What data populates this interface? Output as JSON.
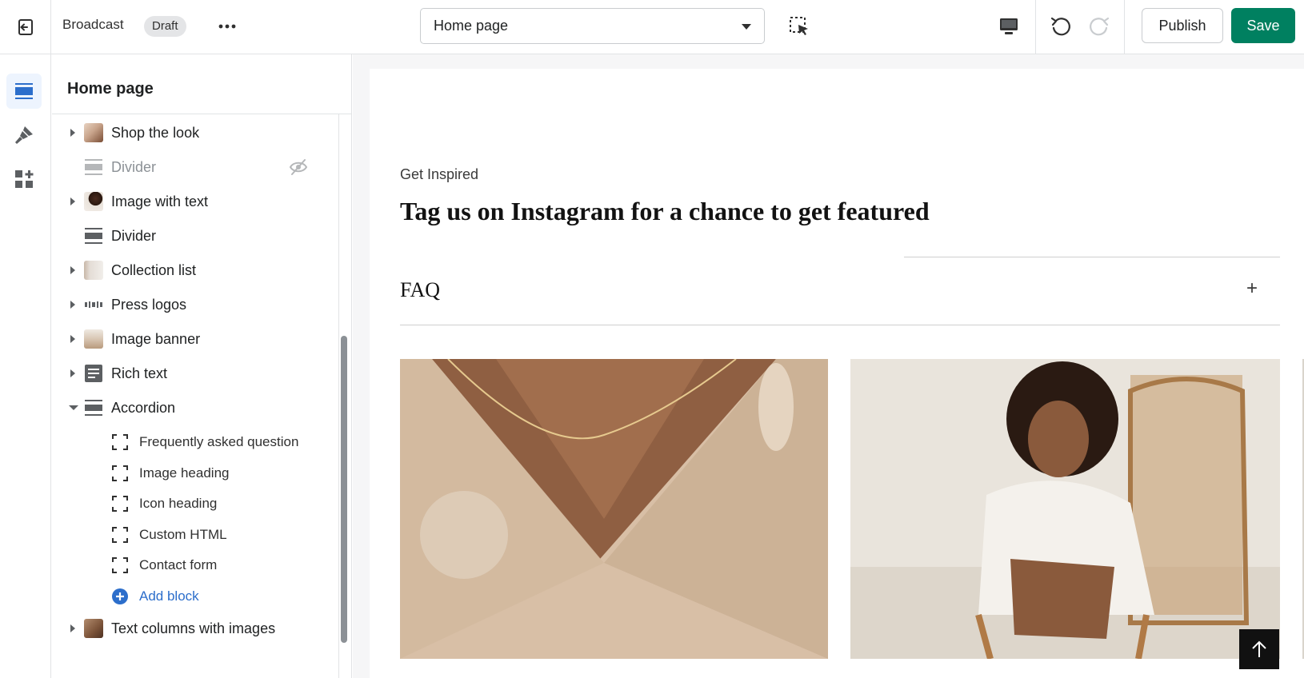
{
  "topbar": {
    "theme_name": "Broadcast",
    "status_badge": "Draft",
    "page_select": {
      "value": "Home page"
    },
    "publish_label": "Publish",
    "save_label": "Save",
    "save_color": "#008060"
  },
  "rail": {
    "items": [
      {
        "icon": "sections-icon",
        "active": true
      },
      {
        "icon": "theme-settings-brush-icon",
        "active": false
      },
      {
        "icon": "app-blocks-icon",
        "active": false
      }
    ]
  },
  "sidebar": {
    "title": "Home page",
    "sections": [
      {
        "label": "Shop the look",
        "expandable": true,
        "thumb": "photo"
      },
      {
        "label": "Divider",
        "expandable": false,
        "hidden": true,
        "thumb": "divider-icon"
      },
      {
        "label": "Image with text",
        "expandable": true,
        "thumb": "photo"
      },
      {
        "label": "Divider",
        "expandable": false,
        "thumb": "divider-icon"
      },
      {
        "label": "Collection list",
        "expandable": true,
        "thumb": "photo"
      },
      {
        "label": "Press logos",
        "expandable": true,
        "thumb": "logos"
      },
      {
        "label": "Image banner",
        "expandable": true,
        "thumb": "photo"
      },
      {
        "label": "Rich text",
        "expandable": true,
        "thumb": "text-icon"
      },
      {
        "label": "Accordion",
        "expandable": true,
        "expanded": true,
        "thumb": "divider-icon"
      }
    ],
    "accordion_blocks": [
      "Frequently asked question",
      "Image heading",
      "Icon heading",
      "Custom HTML",
      "Contact form"
    ],
    "add_block_label": "Add block",
    "after_section": {
      "label": "Text columns with images",
      "expandable": true,
      "thumb": "photo"
    }
  },
  "preview": {
    "eyebrow": "Get Inspired",
    "headline": "Tag us on Instagram for a chance to get featured",
    "faq_title": "FAQ",
    "faq_toggle": "+"
  }
}
